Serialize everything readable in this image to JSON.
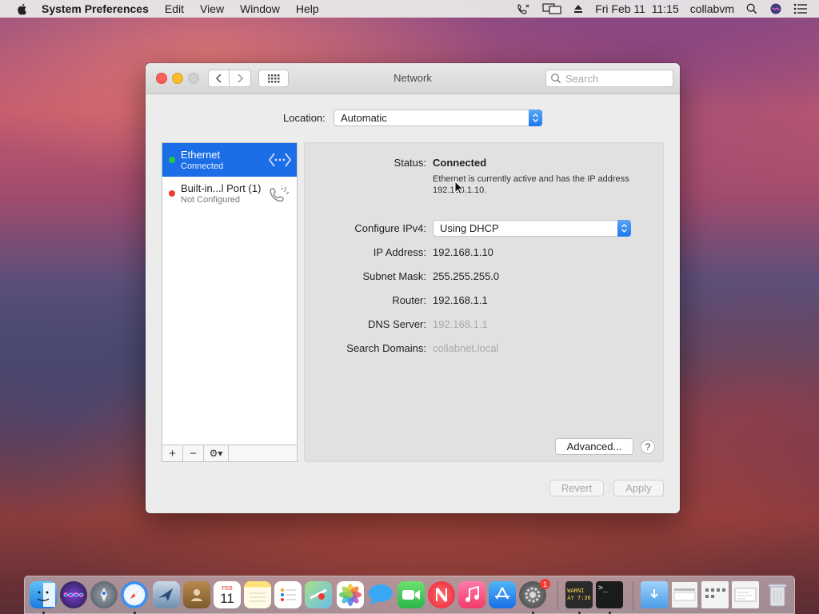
{
  "menubar": {
    "app_name": "System Preferences",
    "items": [
      "Edit",
      "View",
      "Window",
      "Help"
    ],
    "datetime": "Fri Feb 11  11:15",
    "user": "collabvm"
  },
  "window": {
    "title": "Network",
    "search_placeholder": "Search"
  },
  "location": {
    "label": "Location:",
    "value": "Automatic"
  },
  "services": [
    {
      "name": "Ethernet",
      "status": "Connected",
      "status_color": "#28c940",
      "selected": true
    },
    {
      "name": "Built-in...l Port (1)",
      "status": "Not Configured",
      "status_color": "#f23b30",
      "selected": false
    }
  ],
  "sidebar_toolbar": {
    "add": "+",
    "remove": "−",
    "gear": "⚙▾"
  },
  "detail": {
    "status_label": "Status:",
    "status_value": "Connected",
    "status_desc": "Ethernet is currently active and has the IP address 192.168.1.10.",
    "ipv4_label": "Configure IPv4:",
    "ipv4_value": "Using DHCP",
    "ip_label": "IP Address:",
    "ip_value": "192.168.1.10",
    "subnet_label": "Subnet Mask:",
    "subnet_value": "255.255.255.0",
    "router_label": "Router:",
    "router_value": "192.168.1.1",
    "dns_label": "DNS Server:",
    "dns_value": "192.168.1.1",
    "domains_label": "Search Domains:",
    "domains_value": "collabnet.local",
    "advanced_label": "Advanced...",
    "help_label": "?"
  },
  "footer": {
    "revert_label": "Revert",
    "apply_label": "Apply"
  },
  "dock": {
    "calendar_month": "FEB",
    "calendar_day": "11",
    "badge_count": "1",
    "console_text": "WARNI\nAY 7:36",
    "terminal_text": ">_"
  },
  "colors": {
    "accent": "#1b6ee8",
    "connected": "#28c940",
    "error": "#f23b30"
  }
}
